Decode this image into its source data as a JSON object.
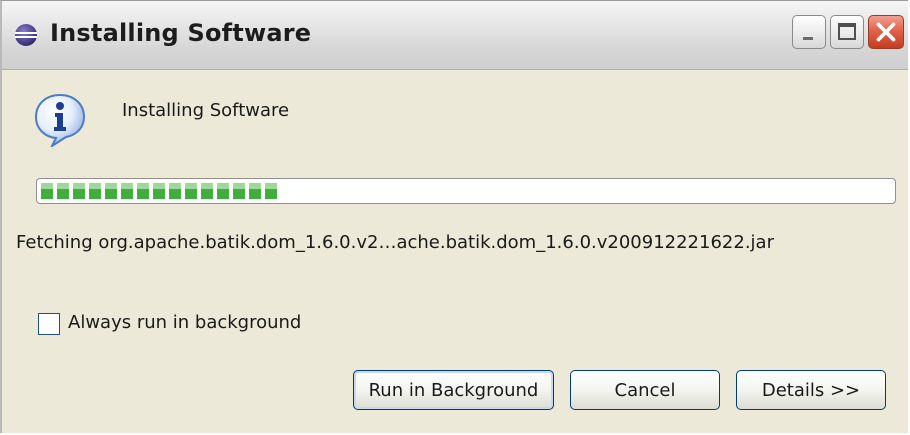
{
  "window": {
    "title": "Installing Software",
    "app_icon": "eclipse-icon",
    "controls": {
      "minimize_icon": "minimize-icon",
      "maximize_icon": "maximize-icon",
      "close_icon": "close-icon"
    }
  },
  "dialog": {
    "icon": "info-icon",
    "message": "Installing Software",
    "progress_fraction": 0.29,
    "progress_color": "#3fae3b",
    "task": "Fetching org.apache.batik.dom_1.6.0.v2…ache.batik.dom_1.6.0.v200912221622.jar",
    "checkbox": {
      "label": "Always run in background",
      "checked": false
    },
    "buttons": {
      "run_in_background": "Run in Background",
      "cancel": "Cancel",
      "details": "Details >>"
    }
  }
}
